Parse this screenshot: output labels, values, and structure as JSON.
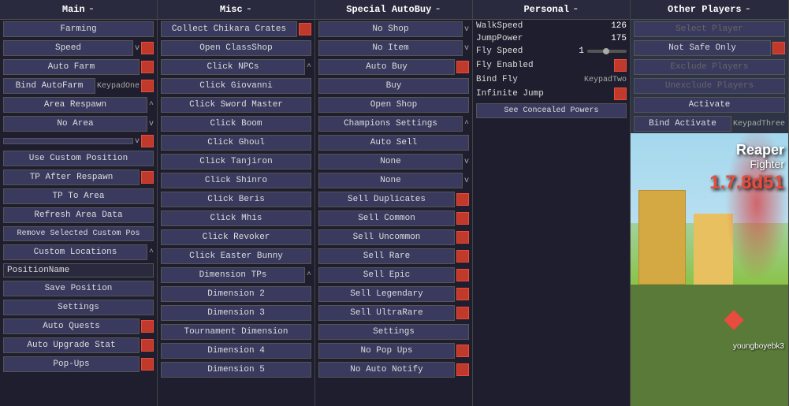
{
  "panels": {
    "main": {
      "title": "Main",
      "buttons": [
        {
          "label": "Farming",
          "type": "btn-full",
          "indicator": null
        },
        {
          "label": "Speed",
          "type": "btn-full",
          "indicator": "v",
          "has_red": true
        },
        {
          "label": "Auto Farm",
          "type": "btn-full",
          "indicator": null,
          "has_red": true
        },
        {
          "label": "Bind AutoFarm",
          "type": "btn-half",
          "indicator": null,
          "keybind": "KeypadOne",
          "has_red": true
        },
        {
          "label": "Area Respawn",
          "type": "btn-full",
          "indicator": "^"
        },
        {
          "label": "No Area",
          "type": "btn-full",
          "indicator": "v"
        },
        {
          "label": "",
          "type": "btn-full",
          "indicator": "v",
          "has_red": true
        },
        {
          "label": "Use Custom Position",
          "type": "btn-full"
        },
        {
          "label": "TP After Respawn",
          "type": "btn-full",
          "has_red": true
        },
        {
          "label": "TP To Area",
          "type": "btn-full"
        },
        {
          "label": "Refresh Area Data",
          "type": "btn-full"
        },
        {
          "label": "Remove Selected Custom Pos",
          "type": "btn-full"
        },
        {
          "label": "Custom Locations",
          "type": "btn-full",
          "indicator": "^"
        },
        {
          "label": "PositionName",
          "type": "input"
        },
        {
          "label": "Save Position",
          "type": "btn-full"
        },
        {
          "label": "Settings",
          "type": "btn-full"
        },
        {
          "label": "Auto Quests",
          "type": "btn-full",
          "has_red": true
        },
        {
          "label": "Auto Upgrade Stat",
          "type": "btn-full",
          "has_red": true
        },
        {
          "label": "Pop-Ups",
          "type": "btn-full",
          "has_red": true
        }
      ]
    },
    "misc": {
      "title": "Misc",
      "buttons": [
        {
          "label": "Collect Chikara Crates",
          "type": "btn-full",
          "has_red": true
        },
        {
          "label": "Open ClassShop",
          "type": "btn-full"
        },
        {
          "label": "Click NPCs",
          "type": "btn-full",
          "indicator": "^"
        },
        {
          "label": "Click Giovanni",
          "type": "btn-full"
        },
        {
          "label": "Click Sword Master",
          "type": "btn-full"
        },
        {
          "label": "Click Boom",
          "type": "btn-full"
        },
        {
          "label": "Click Ghoul",
          "type": "btn-full"
        },
        {
          "label": "Click Tanjiron",
          "type": "btn-full"
        },
        {
          "label": "Click Shinro",
          "type": "btn-full"
        },
        {
          "label": "Click Beris",
          "type": "btn-full"
        },
        {
          "label": "Click Mhis",
          "type": "btn-full"
        },
        {
          "label": "Click Revoker",
          "type": "btn-full"
        },
        {
          "label": "Click Easter Bunny",
          "type": "btn-full"
        },
        {
          "label": "Dimension TPs",
          "type": "btn-full",
          "indicator": "^"
        },
        {
          "label": "Dimension 2",
          "type": "btn-full"
        },
        {
          "label": "Dimension 3",
          "type": "btn-full"
        },
        {
          "label": "Tournament Dimension",
          "type": "btn-full"
        },
        {
          "label": "Dimension 4",
          "type": "btn-full"
        },
        {
          "label": "Dimension 5",
          "type": "btn-full"
        }
      ]
    },
    "special": {
      "title": "Special AutoBuy",
      "buttons": [
        {
          "label": "No Shop",
          "type": "btn-full",
          "indicator": "v"
        },
        {
          "label": "No Item",
          "type": "btn-full",
          "indicator": "v"
        },
        {
          "label": "Auto Buy",
          "type": "btn-full",
          "has_red": true
        },
        {
          "label": "Buy",
          "type": "btn-full"
        },
        {
          "label": "Open Shop",
          "type": "btn-full"
        },
        {
          "label": "Champions Settings",
          "type": "btn-full",
          "indicator": "^"
        },
        {
          "label": "Auto Sell",
          "type": "btn-full"
        },
        {
          "label": "None",
          "type": "btn-full",
          "indicator": "v"
        },
        {
          "label": "None",
          "type": "btn-full",
          "indicator": "v"
        },
        {
          "label": "Sell Duplicates",
          "type": "btn-full",
          "has_red": true
        },
        {
          "label": "Sell Common",
          "type": "btn-full",
          "has_red": true
        },
        {
          "label": "Sell Uncommon",
          "type": "btn-full",
          "has_red": true
        },
        {
          "label": "Sell Rare",
          "type": "btn-full",
          "has_red": true
        },
        {
          "label": "Sell Epic",
          "type": "btn-full",
          "has_red": true
        },
        {
          "label": "Sell Legendary",
          "type": "btn-full",
          "has_red": true
        },
        {
          "label": "Sell UltraRare",
          "type": "btn-full",
          "has_red": true
        },
        {
          "label": "Settings",
          "type": "btn-full"
        },
        {
          "label": "No Pop Ups",
          "type": "btn-full",
          "has_red": true
        },
        {
          "label": "No Auto Notify",
          "type": "btn-full",
          "has_red": true
        }
      ]
    },
    "personal": {
      "title": "Personal",
      "rows": [
        {
          "label": "WalkSpeed",
          "value": "126",
          "type": "value"
        },
        {
          "label": "JumpPower",
          "value": "175",
          "type": "value"
        },
        {
          "label": "Fly Speed",
          "value": "1",
          "type": "slider"
        },
        {
          "label": "Fly Enabled",
          "value": "",
          "type": "toggle",
          "has_red": true
        },
        {
          "label": "Bind Fly",
          "value": "KeypadTwo",
          "type": "keybind"
        },
        {
          "label": "Infinite Jump",
          "value": "",
          "type": "toggle",
          "has_red": true
        },
        {
          "label": "See Concealed Powers",
          "value": "",
          "type": "button"
        }
      ]
    },
    "other": {
      "title": "Other Players",
      "buttons": [
        {
          "label": "Select Player",
          "type": "btn-full",
          "disabled": true
        },
        {
          "label": "Not Safe Only",
          "type": "btn-full",
          "has_red": true
        },
        {
          "label": "Exclude Players",
          "type": "btn-full",
          "disabled": true
        },
        {
          "label": "Unexclude Players",
          "type": "btn-full",
          "disabled": true
        },
        {
          "label": "Activate",
          "type": "btn-full"
        },
        {
          "label": "Bind Activate",
          "type": "btn-half",
          "keybind": "KeypadThree"
        }
      ],
      "game_text": {
        "reaper": "Reaper",
        "fighter": "Fighter",
        "version": "1.7.8d51",
        "username": "youngboyebk3"
      }
    }
  }
}
